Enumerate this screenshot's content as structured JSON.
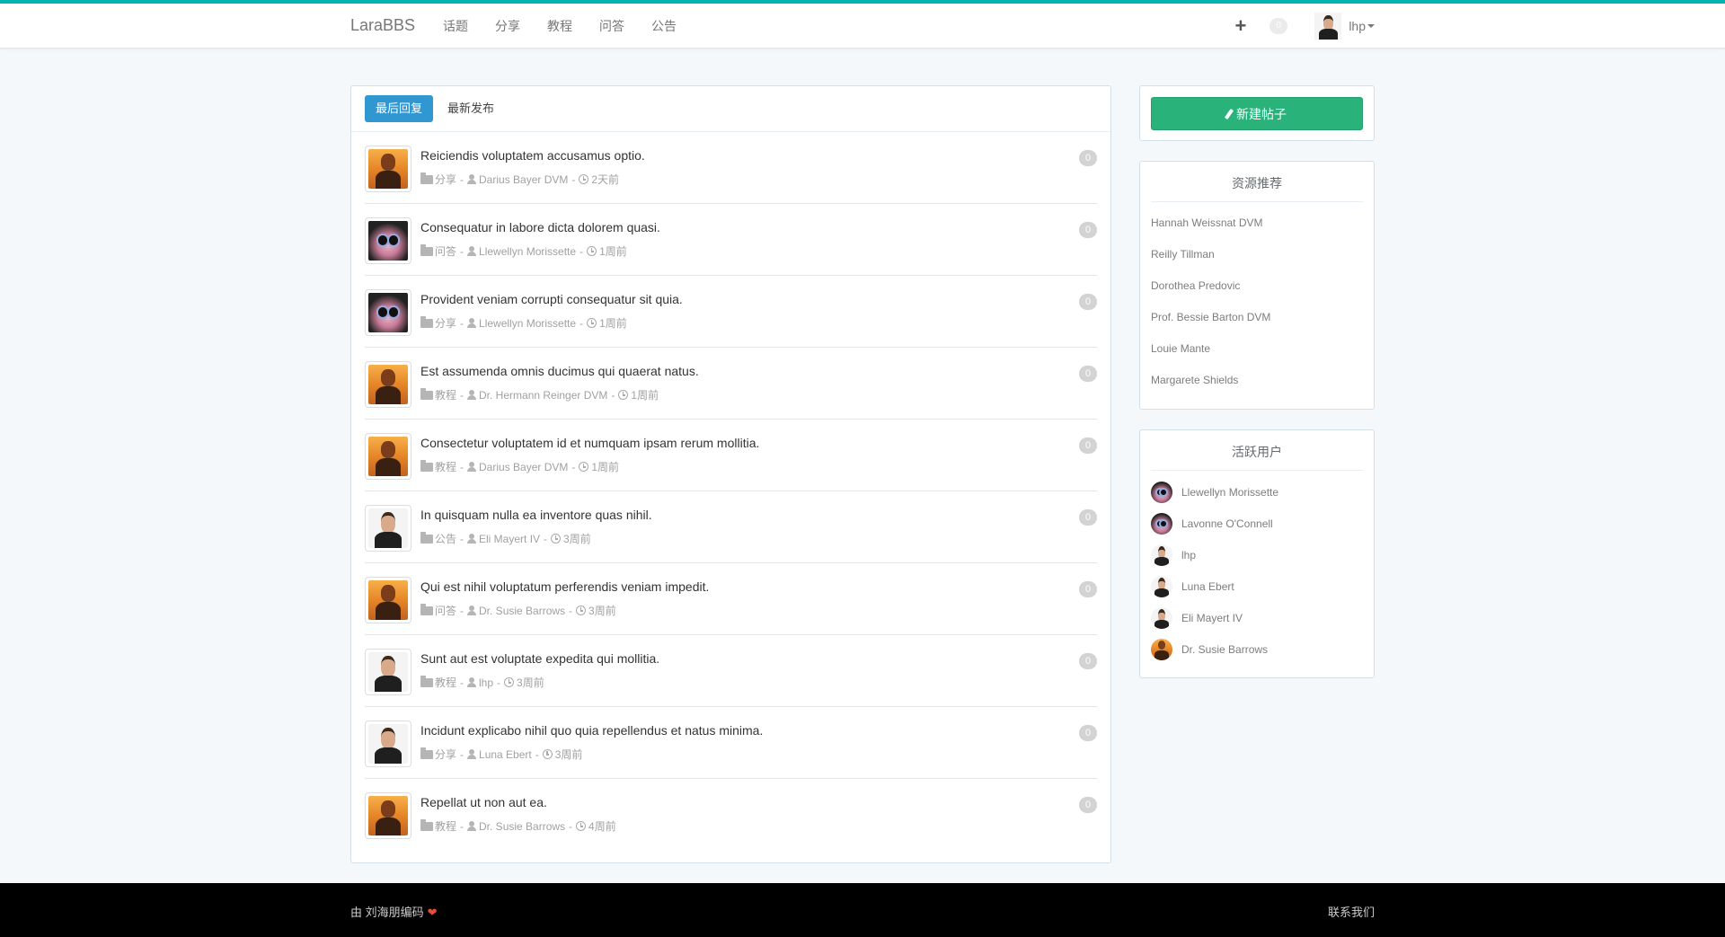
{
  "nav": {
    "brand": "LaraBBS",
    "links": [
      "话题",
      "分享",
      "教程",
      "问答",
      "公告"
    ],
    "plus_icon": "plus-icon",
    "notification_count": "0",
    "username": "lhp"
  },
  "tabs": {
    "last_reply": "最后回复",
    "latest": "最新发布"
  },
  "topics": [
    {
      "title": "Reiciendis voluptatem accusamus optio.",
      "category": "分享",
      "author": "Darius Bayer DVM",
      "time": "2天前",
      "replies": "0",
      "avatar": "a"
    },
    {
      "title": "Consequatur in labore dicta dolorem quasi.",
      "category": "问答",
      "author": "Llewellyn Morissette",
      "time": "1周前",
      "replies": "0",
      "avatar": "b"
    },
    {
      "title": "Provident veniam corrupti consequatur sit quia.",
      "category": "分享",
      "author": "Llewellyn Morissette",
      "time": "1周前",
      "replies": "0",
      "avatar": "b"
    },
    {
      "title": "Est assumenda omnis ducimus qui quaerat natus.",
      "category": "教程",
      "author": "Dr. Hermann Reinger DVM",
      "time": "1周前",
      "replies": "0",
      "avatar": "a"
    },
    {
      "title": "Consectetur voluptatem id et numquam ipsam rerum mollitia.",
      "category": "教程",
      "author": "Darius Bayer DVM",
      "time": "1周前",
      "replies": "0",
      "avatar": "a"
    },
    {
      "title": "In quisquam nulla ea inventore quas nihil.",
      "category": "公告",
      "author": "Eli Mayert IV",
      "time": "3周前",
      "replies": "0",
      "avatar": "c"
    },
    {
      "title": "Qui est nihil voluptatum perferendis veniam impedit.",
      "category": "问答",
      "author": "Dr. Susie Barrows",
      "time": "3周前",
      "replies": "0",
      "avatar": "a"
    },
    {
      "title": "Sunt aut est voluptate expedita qui mollitia.",
      "category": "教程",
      "author": "lhp",
      "time": "3周前",
      "replies": "0",
      "avatar": "c"
    },
    {
      "title": "Incidunt explicabo nihil quo quia repellendus et natus minima.",
      "category": "分享",
      "author": "Luna Ebert",
      "time": "3周前",
      "replies": "0",
      "avatar": "c"
    },
    {
      "title": "Repellat ut non aut ea.",
      "category": "教程",
      "author": "Dr. Susie Barrows",
      "time": "4周前",
      "replies": "0",
      "avatar": "a"
    }
  ],
  "sidebar": {
    "new_post": "新建帖子",
    "resources_title": "资源推荐",
    "resources": [
      "Hannah Weissnat DVM",
      "Reilly Tillman",
      "Dorothea Predovic",
      "Prof. Bessie Barton DVM",
      "Louie Mante",
      "Margarete Shields"
    ],
    "active_title": "活跃用户",
    "active_users": [
      {
        "name": "Llewellyn Morissette",
        "avatar": "b"
      },
      {
        "name": "Lavonne O'Connell",
        "avatar": "b"
      },
      {
        "name": "lhp",
        "avatar": "c"
      },
      {
        "name": "Luna Ebert",
        "avatar": "c"
      },
      {
        "name": "Eli Mayert IV",
        "avatar": "c"
      },
      {
        "name": "Dr. Susie Barrows",
        "avatar": "a"
      }
    ]
  },
  "footer": {
    "credit": "由 刘海朋编码",
    "heart": "❤",
    "contact": "联系我们"
  },
  "colors": {
    "accent": "#00b5ad",
    "primary": "#3097d1",
    "success": "#2ab27b"
  }
}
